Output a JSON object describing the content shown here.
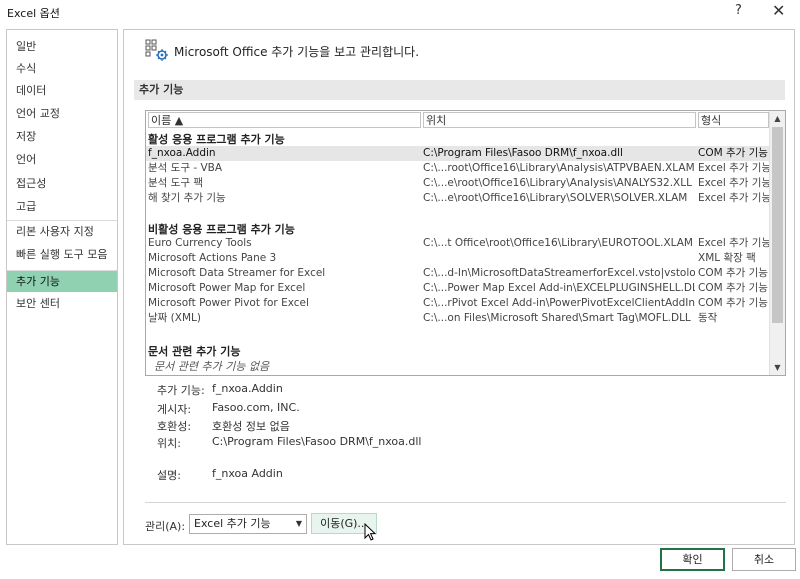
{
  "window": {
    "title": "Excel 옵션",
    "help": "?",
    "close": "✕"
  },
  "sidebar": {
    "items": [
      {
        "label": "일반"
      },
      {
        "label": "수식"
      },
      {
        "label": "데이터"
      },
      {
        "label": "언어 교정"
      },
      {
        "label": "저장"
      },
      {
        "label": "언어"
      },
      {
        "label": "접근성"
      },
      {
        "label": "고급"
      },
      {
        "label": "리본 사용자 지정"
      },
      {
        "label": "빠른 실행 도구 모음"
      },
      {
        "label": "추가 기능"
      },
      {
        "label": "보안 센터"
      }
    ],
    "selected": "추가 기능"
  },
  "header": {
    "text": "Microsoft Office 추가 기능을 보고 관리합니다."
  },
  "section": {
    "title": "추가 기능"
  },
  "table": {
    "columns": [
      "이름 ▲",
      "위치",
      "형식"
    ],
    "groups": [
      {
        "title": "활성 응용 프로그램 추가 기능",
        "rows": [
          {
            "name": "f_nxoa.Addin",
            "location": "C:\\Program Files\\Fasoo DRM\\f_nxoa.dll",
            "type": "COM 추가 기능"
          },
          {
            "name": "분석 도구 - VBA",
            "location": "C:\\...root\\Office16\\Library\\Analysis\\ATPVBAEN.XLAM",
            "type": "Excel 추가 기능"
          },
          {
            "name": "분석 도구 팩",
            "location": "C:\\...e\\root\\Office16\\Library\\Analysis\\ANALYS32.XLL",
            "type": "Excel 추가 기능"
          },
          {
            "name": "해 찾기 추가 기능",
            "location": "C:\\...e\\root\\Office16\\Library\\SOLVER\\SOLVER.XLAM",
            "type": "Excel 추가 기능"
          }
        ]
      },
      {
        "title": "비활성 응용 프로그램 추가 기능",
        "rows": [
          {
            "name": "Euro Currency Tools",
            "location": "C:\\...t Office\\root\\Office16\\Library\\EUROTOOL.XLAM",
            "type": "Excel 추가 기능"
          },
          {
            "name": "Microsoft Actions Pane 3",
            "location": "",
            "type": "XML 확장 팩"
          },
          {
            "name": "Microsoft Data Streamer for Excel",
            "location": "C:\\...d-In\\MicrosoftDataStreamerforExcel.vsto|vstolocal",
            "type": "COM 추가 기능"
          },
          {
            "name": "Microsoft Power Map for Excel",
            "location": "C:\\...Power Map Excel Add-in\\EXCELPLUGINSHELL.DLL",
            "type": "COM 추가 기능"
          },
          {
            "name": "Microsoft Power Pivot for Excel",
            "location": "C:\\...rPivot Excel Add-in\\PowerPivotExcelClientAddIn.dll",
            "type": "COM 추가 기능"
          },
          {
            "name": "날짜 (XML)",
            "location": "C:\\...on Files\\Microsoft Shared\\Smart Tag\\MOFL.DLL",
            "type": "동작"
          }
        ]
      },
      {
        "title": "문서 관련 추가 기능",
        "empty": "문서 관련 추가 기능 없음"
      }
    ]
  },
  "detail": {
    "addin_label": "추가 기능:",
    "addin_value": "f_nxoa.Addin",
    "publisher_label": "게시자:",
    "publisher_value": "Fasoo.com, INC.",
    "compat_label": "호환성:",
    "compat_value": "호환성 정보 없음",
    "location_label": "위치:",
    "location_value": "C:\\Program Files\\Fasoo DRM\\f_nxoa.dll",
    "desc_label": "설명:",
    "desc_value": "f_nxoa Addin"
  },
  "manage": {
    "label": "관리(A):",
    "selected": "Excel 추가 기능",
    "go_label": "이동(G)..."
  },
  "buttons": {
    "ok": "확인",
    "cancel": "취소"
  },
  "colors": {
    "accent": "#217346",
    "selected_nav": "#8fd1b0"
  }
}
